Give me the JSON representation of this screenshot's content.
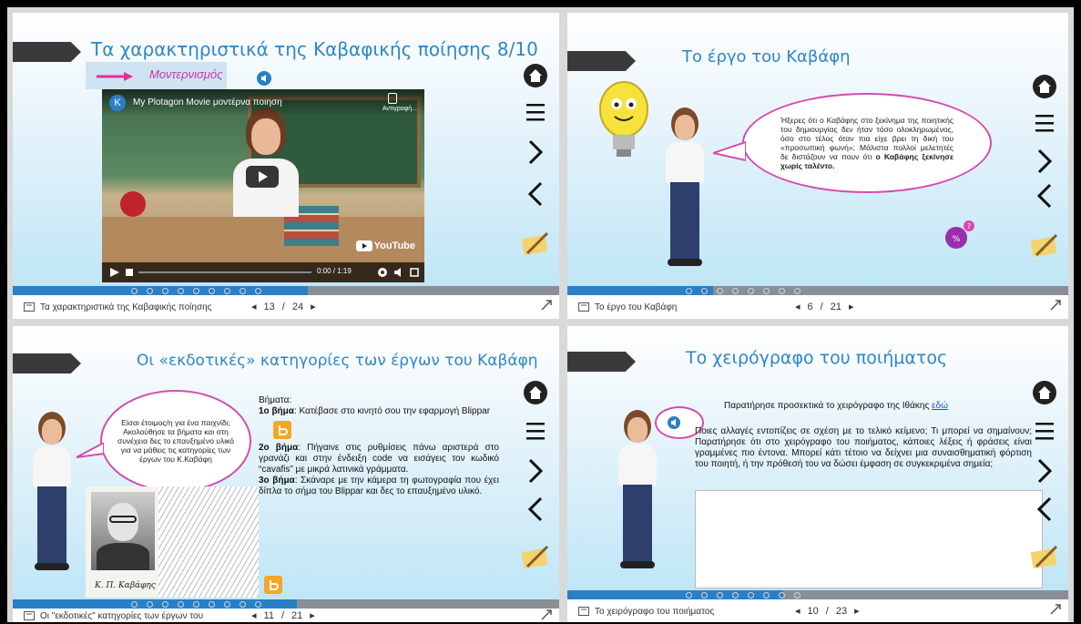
{
  "slides": [
    {
      "title": "Τα χαρακτηριστικά της Καβαφικής ποίησης 8/10",
      "subtitle": "Μοντερνισμός",
      "video": {
        "channel_letter": "K",
        "title": "My Plotagon Movie μοντέρνα ποιηση",
        "copy_label": "Αντιγραφή...",
        "time": "0:00 / 1:19",
        "brand": "YouTube"
      },
      "footer_name": "Τα χαρακτηριστικά της Καβαφικής ποίησης",
      "page_current": "13",
      "page_total": "24",
      "progress": 0.54
    },
    {
      "title": "Το έργο του Καβάφη",
      "bubble_text": "Ήξερες ότι ο Καβάφης στο ξεκίνημα της ποιητικής του δημιουργίας δεν ήταν τόσο ολοκληρωμένος, όσο στο τέλος όταν πια είχε βρει τη δική του «προσωπική φωνή»; Μάλιστα πολλοί μελετητές δε διστάζουν να πουν  ότι ",
      "bubble_bold": "ο Καβάφης ξεκίνησε χωρίς ταλέντο.",
      "footer_name": "Το έργο του Καβάφη",
      "page_current": "6",
      "page_total": "21",
      "progress": 0.29
    },
    {
      "title": "Οι «εκδοτικές» κατηγορίες των έργων του Καβάφη",
      "bubble_text": "Είσαι έτοιμος/η για ένα παιχνίδι; Ακολούθησε τα βήματα και στη συνέχεια δες το επαυξημένο υλικό για να μάθεις τις κατηγορίες των έργων του Κ.Καβάφη",
      "steps_heading": "Βήματα:",
      "step1_label": "1ο βήμα",
      "step1_text": ": Κατέβασε στο κινητό σου την εφαρμογή Blippar",
      "step2_label": "2ο βήμα",
      "step2_text": ": Πήγαινε στις ρυθμίσεις πάνω αριστερά στο γρανάζι και στην ένδειξη code να εισάγεις τον κωδικό “cavafis” με μικρά λατινικά γράμματα.",
      "step3_label": "3ο βήμα",
      "step3_text": ": Σκάναρε με την κάμερα τη φωτογραφία που έχει δίπλα το σήμα του Blippar και δες το επαυξημένο υλικό.",
      "signature": "Κ. Π. Καβάφης",
      "footer_name": "Οι \"εκδοτικές\" κατηγορίες των έργων του",
      "page_current": "11",
      "page_total": "21",
      "progress": 0.52
    },
    {
      "title": "Το χειρόγραφο του ποιήματος",
      "intro_text": "Παρατήρησε προσεκτικά το χειρόγραφο της Ιθάκης ",
      "intro_link": "εδώ",
      "question_text": "Ποιες αλλαγές εντοπίζεις σε σχέση με το τελικό κείμενο; Τι μπορεί να σημαίνουν; Παρατήρησε ότι στο χειρόγραφο του ποιήματος, κάποιες λέξεις ή φράσεις είναι γραμμένες πιο έντονα. Μπορεί κάτι τέτοιο να δείχνει μια συναισθηματική φόρτιση του ποιητή, ή την πρόθεσή του να δώσει έμφαση σε συγκεκριμένα σημεία;",
      "answer_value": "",
      "footer_name": "Το χειρόγραφο του ποιήματος",
      "page_current": "10",
      "page_total": "23",
      "progress": 0.43
    }
  ],
  "colors": {
    "title_blue": "#2e86c8",
    "progress_fill": "#2a7fc6",
    "bubble_border": "#d44bb0",
    "arrow_magenta": "#e0309a",
    "blippar_orange": "#f5a623"
  },
  "icons": [
    "home-icon",
    "menu-icon",
    "next-icon",
    "previous-icon",
    "notebook-icon",
    "audio-icon",
    "expand-icon",
    "slides-icon",
    "blippar-icon",
    "lightbulb-icon",
    "help-badge-icon"
  ]
}
